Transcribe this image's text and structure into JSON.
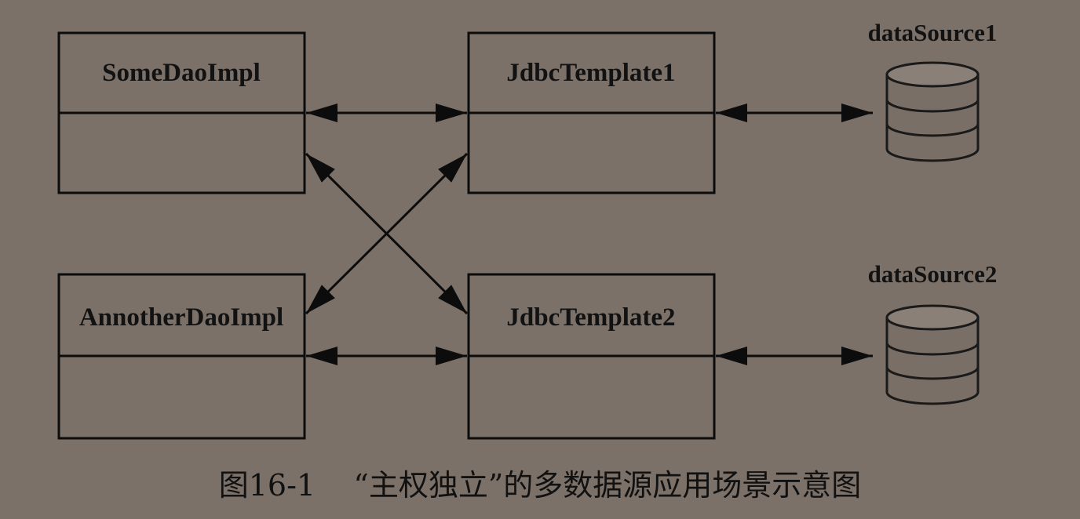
{
  "boxes": {
    "some_dao": "SomeDaoImpl",
    "another_dao": "AnnotherDaoImpl",
    "template1": "JdbcTemplate1",
    "template2": "JdbcTemplate2"
  },
  "data_sources": {
    "ds1": "dataSource1",
    "ds2": "dataSource2"
  },
  "caption": {
    "number": "图16-1",
    "text": "“主权独立”的多数据源应用场景示意图"
  },
  "colors": {
    "background": "#7c7169",
    "ink": "#0c0c0c"
  }
}
